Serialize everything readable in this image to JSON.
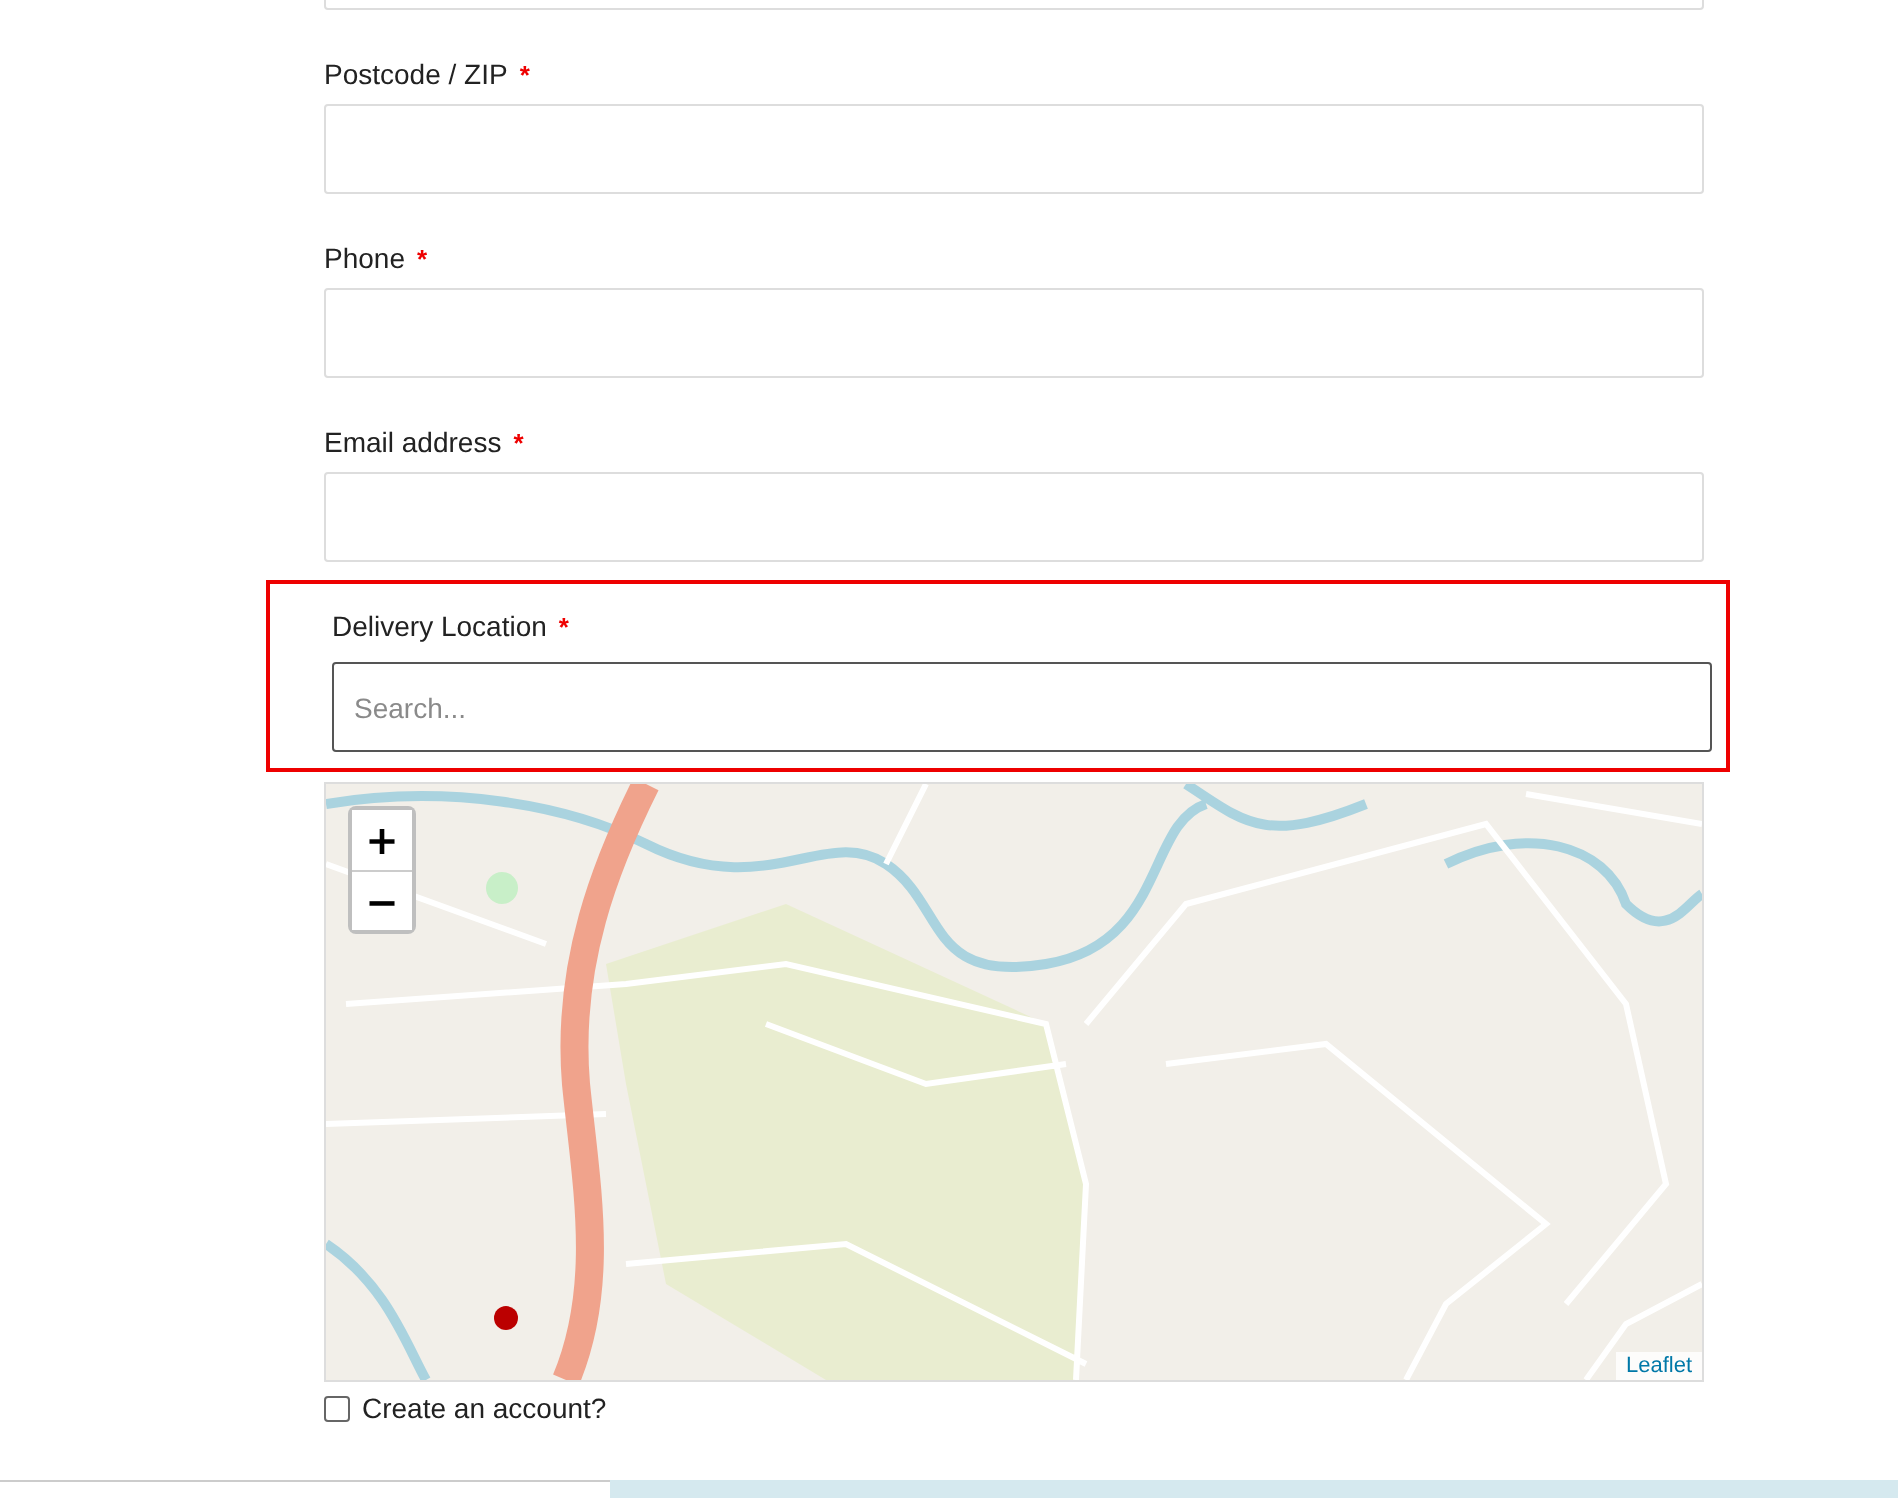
{
  "fields": [
    {
      "label": "Postcode / ZIP",
      "required_mark": "*"
    },
    {
      "label": "Phone",
      "required_mark": "*"
    },
    {
      "label": "Email address",
      "required_mark": "*"
    }
  ],
  "delivery_location": {
    "label": "Delivery Location",
    "required_mark": "*",
    "placeholder": "Search...",
    "highlighted": true
  },
  "map": {
    "zoom_in": "+",
    "zoom_out": "−",
    "attribution": "Leaflet"
  },
  "create_account": {
    "label": "Create an account?",
    "checked": false
  }
}
